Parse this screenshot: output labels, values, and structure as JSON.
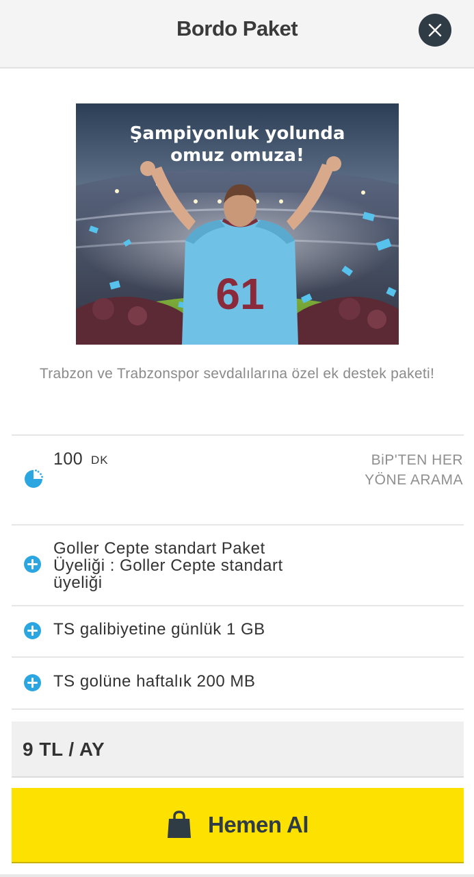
{
  "header": {
    "title": "Bordo Paket",
    "close_icon": "close-icon"
  },
  "hero": {
    "headline_line1": "Şampiyonluk yolunda",
    "headline_line2": "omuz omuza!",
    "jersey_number": "61"
  },
  "description": "Trabzon ve Trabzonspor sevdalılarına özel ek destek paketi!",
  "minutes": {
    "value": "100",
    "unit": "DK",
    "description": "BiP'TEN HER YÖNE ARAMA",
    "icon": "clock-icon"
  },
  "features": [
    {
      "text": "Goller Cepte standart Paket Üyeliği : Goller Cepte standart üyeliği",
      "icon": "plus-circle-icon"
    },
    {
      "text": "TS galibiyetine günlük 1 GB",
      "icon": "plus-circle-icon"
    },
    {
      "text": "TS golüne haftalık 200 MB",
      "icon": "plus-circle-icon"
    }
  ],
  "price": "9 TL / AY",
  "buy_button": {
    "label": "Hemen Al",
    "icon": "shopping-bag-icon"
  },
  "colors": {
    "accent_blue": "#2ba6e0",
    "button_yellow": "#fde100",
    "dark": "#2f3b45"
  }
}
